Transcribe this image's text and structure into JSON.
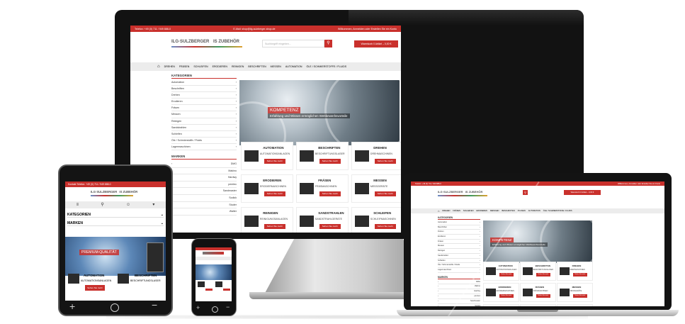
{
  "colors": {
    "accent": "#c9302c",
    "bezel": "#111111"
  },
  "site": {
    "topbar_phone": "Telefon: +49 (0) 711 / 949 888-0",
    "topbar_email": "E-Mail: shop@ilg-sulzberger-shop.de",
    "topbar_welcome": "Willkommen, Anmelden oder Erstellen Sie ein Konto",
    "logo_main": "ILG·SULZBERGER",
    "logo_sub": "IS ZUBEHÖR",
    "search_placeholder": "Suchbegriff eingeben...",
    "cart_label": "Warenkorb 0 Artikel – 0,00 €",
    "nav": [
      "DREHEN",
      "FRÄSEN",
      "SCHLEIFEN",
      "ERODIEREN",
      "REINIGEN",
      "BESCHRIFTEN",
      "MESSEN",
      "AUTOMATION",
      "ÖLE / SCHMIERSTOFFE / FLUIDS"
    ],
    "categories_heading": "KATEGORIEN",
    "categories": [
      "Automation",
      "Beschriften",
      "Drehen",
      "Erodieren",
      "Fräsen",
      "Messen",
      "Reinigen",
      "Sandstrahlen",
      "Schleifen",
      "Öle / Schmierstoffe / Fluids",
      "Lagermaschinen"
    ],
    "brands_heading": "MARKEN",
    "brands": [
      "DMG",
      "Makino",
      "Hardwy",
      "pemtec",
      "Sandmaster",
      "Sodick",
      "Studer",
      "Walter"
    ],
    "banner_title": "KOMPETENZ",
    "banner_sub": "Erfahrung und Wissen ermöglichen Wettbewerbsvorteile",
    "tablet_banner_title": "PREMIUM-QUALITÄT",
    "cards": [
      {
        "title": "AUTOMATION",
        "sub": "AUTOMATIONSANLAGEN",
        "btn": "Sehen Sie mehr"
      },
      {
        "title": "BESCHRIFTEN",
        "sub": "BESCHRIFTUNGSLASER",
        "btn": "Sehen Sie mehr"
      },
      {
        "title": "DREHEN",
        "sub": "DREHMASCHINEN",
        "btn": "Sehen Sie mehr"
      },
      {
        "title": "ERODIEREN",
        "sub": "ERODIERMASCHINEN",
        "btn": "Sehen Sie mehr"
      },
      {
        "title": "FRÄSEN",
        "sub": "FRÄSMASCHINEN",
        "btn": "Sehen Sie mehr"
      },
      {
        "title": "MESSEN",
        "sub": "MESSGERÄTE",
        "btn": "Sehen Sie mehr"
      },
      {
        "title": "REINIGEN",
        "sub": "REINIGUNGSANLAGEN",
        "btn": "Sehen Sie mehr"
      },
      {
        "title": "SANDSTRAHLEN",
        "sub": "SANDSTRAHLGERÄTE",
        "btn": "Sehen Sie mehr"
      },
      {
        "title": "SCHLEIFEN",
        "sub": "SCHLEIFMASCHINEN",
        "btn": "Sehen Sie mehr"
      }
    ],
    "tablet_topbar": "Kontakt   Telefon: +49 (0) 711 / 949 888-0",
    "tablet_categories": "KATEGORIEN",
    "tablet_brands": "MARKEN"
  }
}
